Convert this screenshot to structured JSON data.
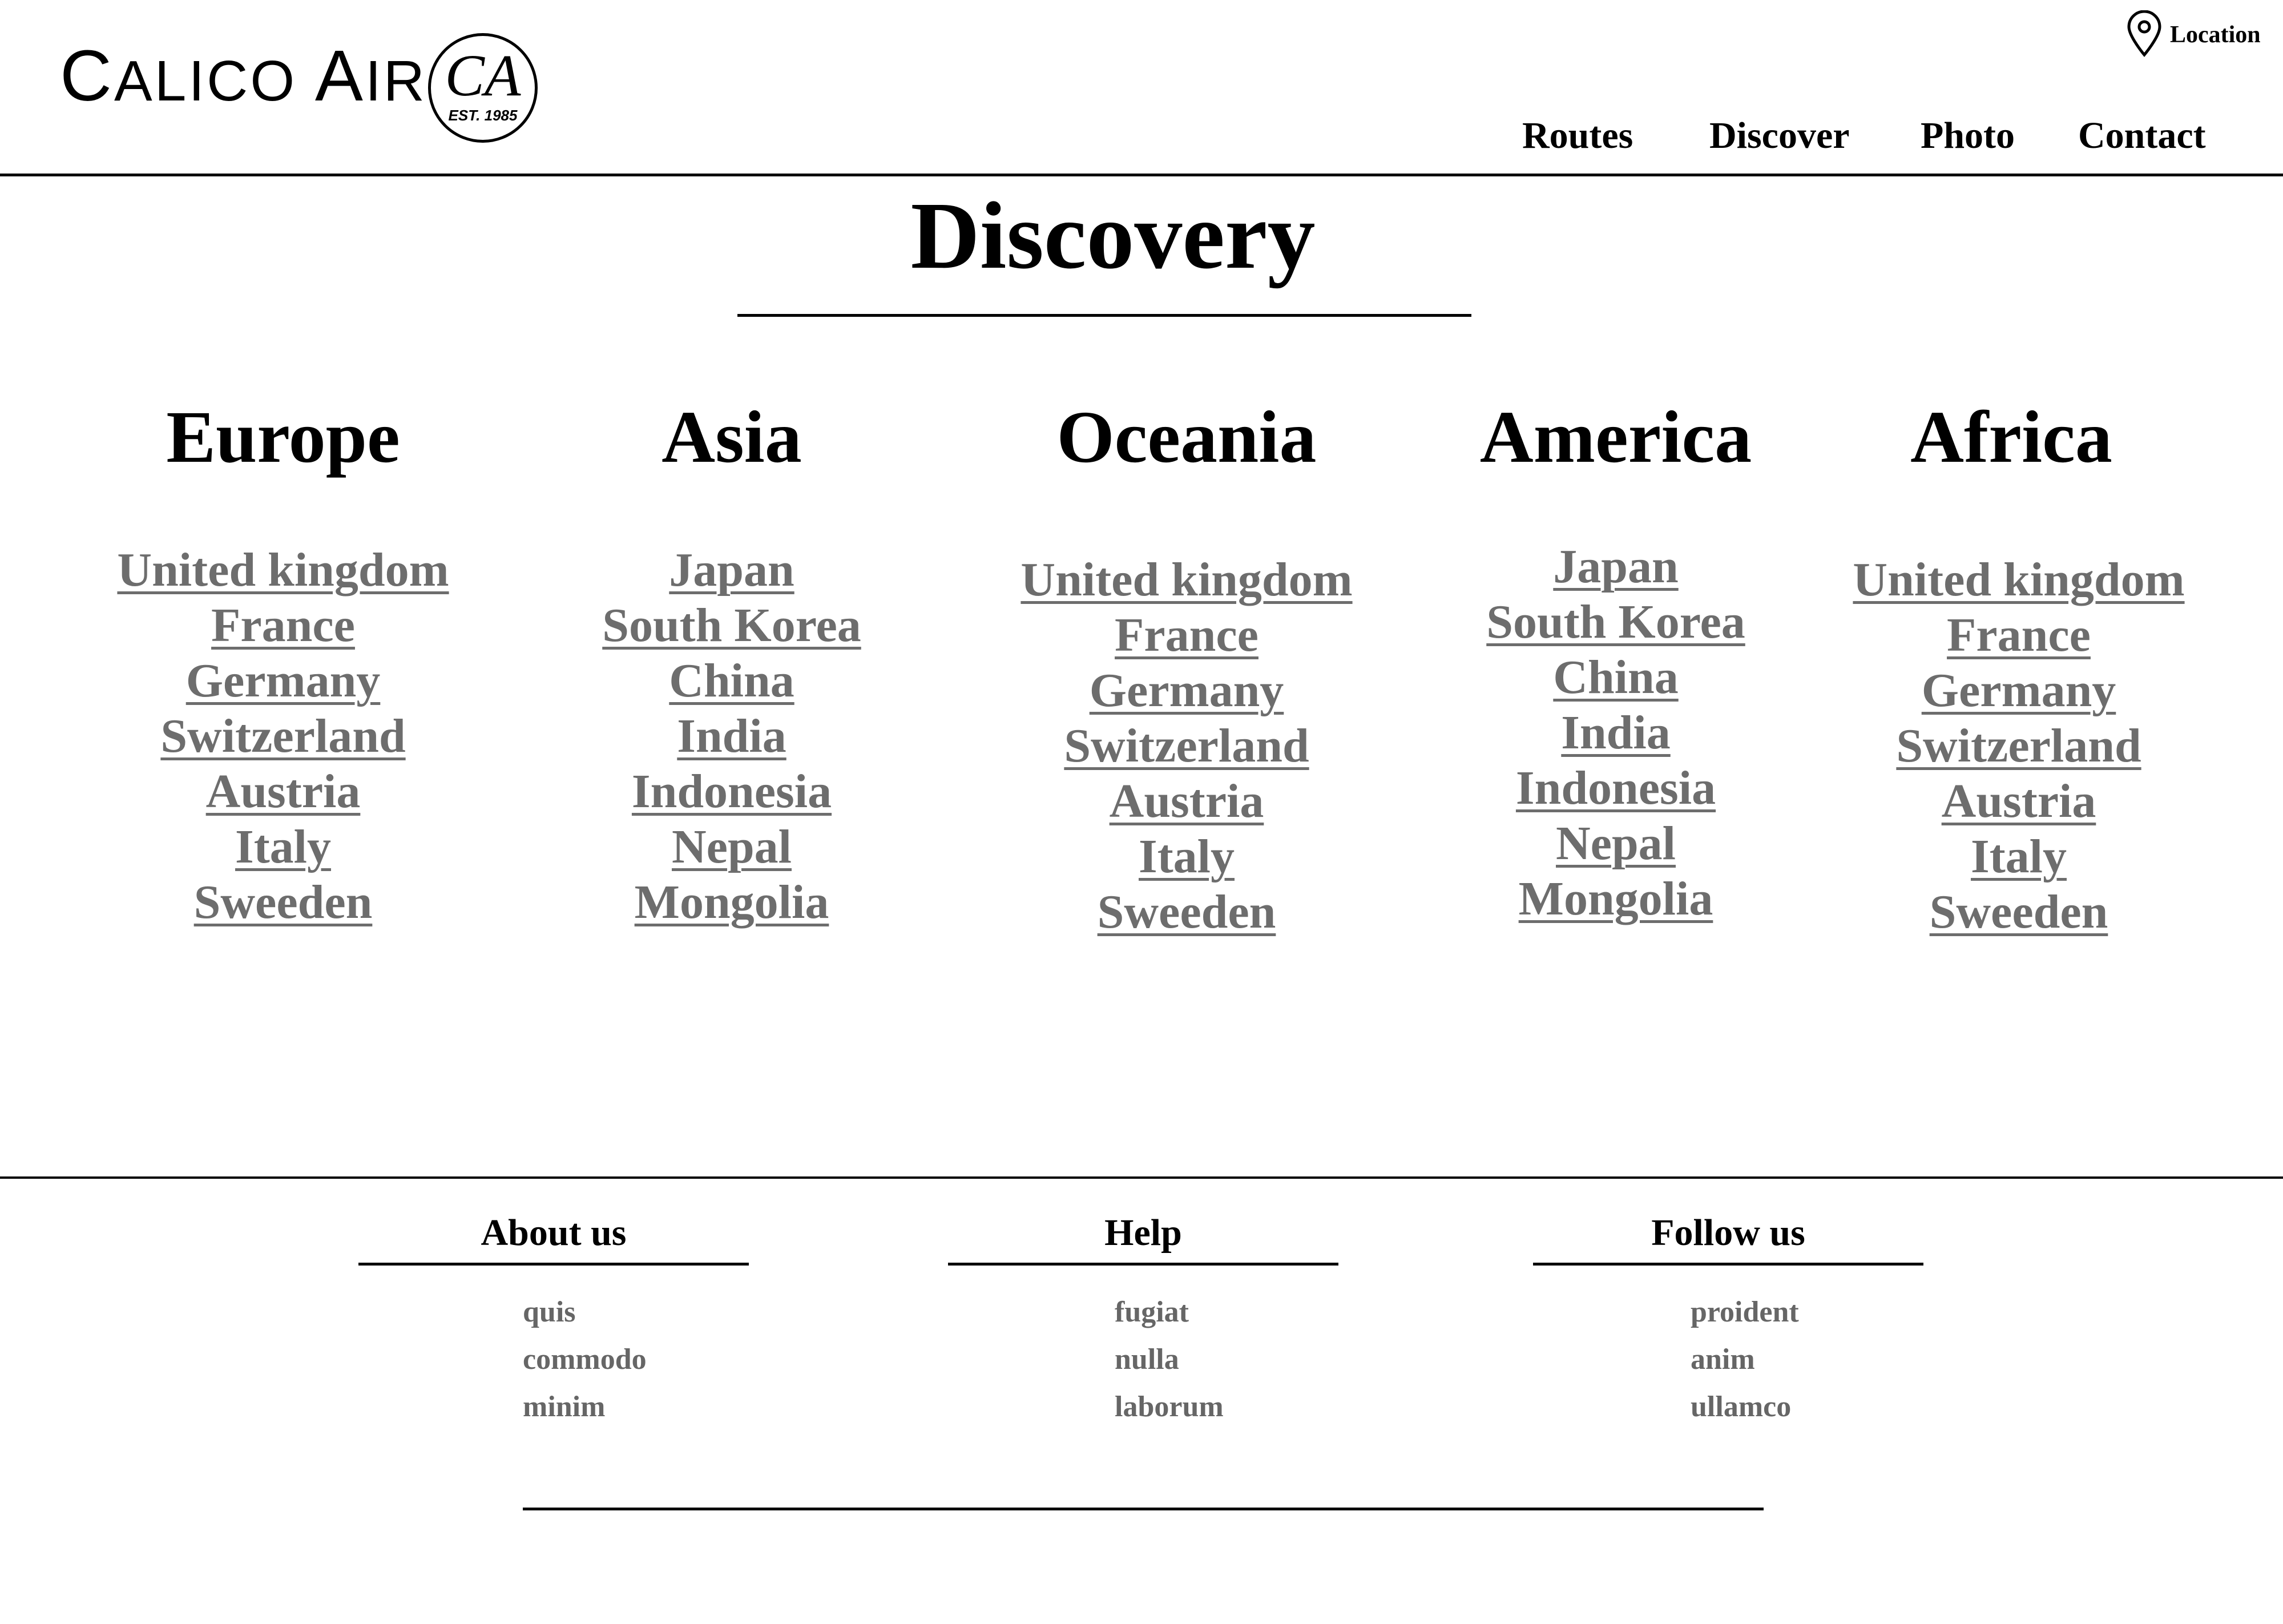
{
  "header": {
    "brand": "CALICO AIR",
    "brand_big_first": "C",
    "brand_small_1": "ALICO ",
    "brand_big_second": "A",
    "brand_small_2": "IR",
    "logo_monogram": "CA",
    "logo_est": "EST. 1985",
    "location_label": "Location",
    "nav": [
      "Routes",
      "Discover",
      "Photo",
      "Contact"
    ]
  },
  "main": {
    "title": "Discovery",
    "regions": [
      {
        "heading": "Europe",
        "countries": [
          "United kingdom",
          "France",
          "Germany",
          "Switzerland",
          "Austria",
          "Italy",
          "Sweeden"
        ]
      },
      {
        "heading": "Asia",
        "countries": [
          "Japan",
          "South Korea",
          "China",
          "India",
          "Indonesia",
          "Nepal",
          "Mongolia"
        ]
      },
      {
        "heading": "Oceania",
        "countries": [
          "United kingdom",
          "France",
          "Germany",
          "Switzerland",
          "Austria",
          "Italy",
          "Sweeden"
        ]
      },
      {
        "heading": "America",
        "countries": [
          "Japan",
          "South Korea",
          "China",
          "India",
          "Indonesia",
          "Nepal",
          "Mongolia"
        ]
      },
      {
        "heading": "Africa",
        "countries": [
          "United kingdom",
          "France",
          "Germany",
          "Switzerland",
          "Austria",
          "Italy",
          "Sweeden"
        ]
      }
    ]
  },
  "footer": {
    "columns": [
      {
        "heading": "About us",
        "links": [
          "quis",
          "commodo",
          "minim"
        ]
      },
      {
        "heading": "Help",
        "links": [
          "fugiat",
          "nulla",
          "laborum"
        ]
      },
      {
        "heading": "Follow us",
        "links": [
          "proident",
          "anim",
          "ullamco"
        ]
      }
    ]
  },
  "colors": {
    "link": "#6d6d6d",
    "footer_link": "#666666",
    "rule": "#000000",
    "background": "#ffffff"
  },
  "icons": {
    "location": "map-pin-icon"
  }
}
